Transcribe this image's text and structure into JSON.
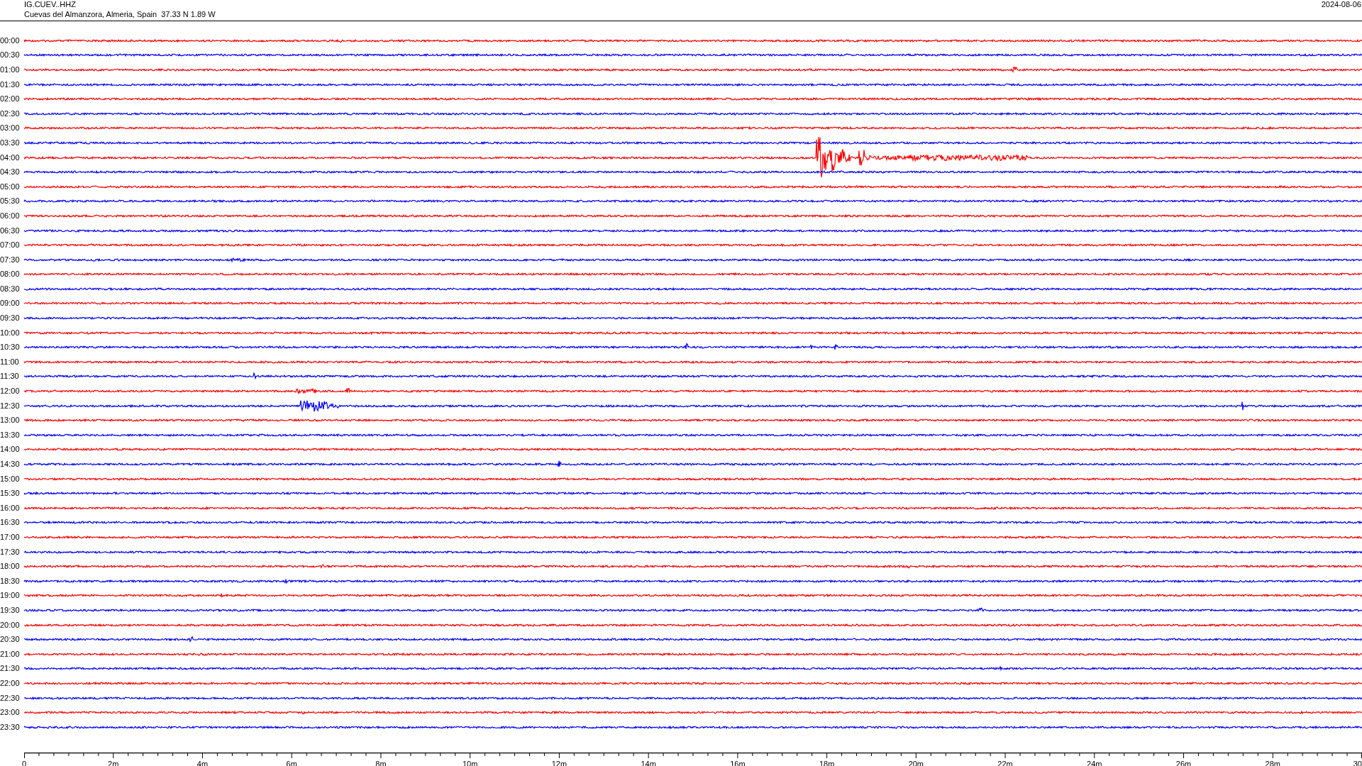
{
  "station": {
    "channel": "IG.CUEV..HHZ",
    "location": "Cuevas del Almanzora, Almeria, Spain  37.33 N 1.89 W",
    "date": "2024-08-06"
  },
  "traces": [
    {
      "time": "00:00",
      "color": "#ff0000"
    },
    {
      "time": "00:30",
      "color": "#0000ff"
    },
    {
      "time": "01:00",
      "color": "#ff0000"
    },
    {
      "time": "01:30",
      "color": "#0000ff"
    },
    {
      "time": "02:00",
      "color": "#ff0000"
    },
    {
      "time": "02:30",
      "color": "#0000ff"
    },
    {
      "time": "03:00",
      "color": "#ff0000"
    },
    {
      "time": "03:30",
      "color": "#0000ff"
    },
    {
      "time": "04:00",
      "color": "#ff0000"
    },
    {
      "time": "04:30",
      "color": "#0000ff"
    },
    {
      "time": "05:00",
      "color": "#ff0000"
    },
    {
      "time": "05:30",
      "color": "#0000ff"
    },
    {
      "time": "06:00",
      "color": "#ff0000"
    },
    {
      "time": "06:30",
      "color": "#0000ff"
    },
    {
      "time": "07:00",
      "color": "#ff0000"
    },
    {
      "time": "07:30",
      "color": "#0000ff"
    },
    {
      "time": "08:00",
      "color": "#ff0000"
    },
    {
      "time": "08:30",
      "color": "#0000ff"
    },
    {
      "time": "09:00",
      "color": "#ff0000"
    },
    {
      "time": "09:30",
      "color": "#0000ff"
    },
    {
      "time": "10:00",
      "color": "#ff0000"
    },
    {
      "time": "10:30",
      "color": "#0000ff"
    },
    {
      "time": "11:00",
      "color": "#ff0000"
    },
    {
      "time": "11:30",
      "color": "#0000ff"
    },
    {
      "time": "12:00",
      "color": "#ff0000"
    },
    {
      "time": "12:30",
      "color": "#0000ff"
    },
    {
      "time": "13:00",
      "color": "#ff0000"
    },
    {
      "time": "13:30",
      "color": "#0000ff"
    },
    {
      "time": "14:00",
      "color": "#ff0000"
    },
    {
      "time": "14:30",
      "color": "#0000ff"
    },
    {
      "time": "15:00",
      "color": "#ff0000"
    },
    {
      "time": "15:30",
      "color": "#0000ff"
    },
    {
      "time": "16:00",
      "color": "#ff0000"
    },
    {
      "time": "16:30",
      "color": "#0000ff"
    },
    {
      "time": "17:00",
      "color": "#ff0000"
    },
    {
      "time": "17:30",
      "color": "#0000ff"
    },
    {
      "time": "18:00",
      "color": "#ff0000"
    },
    {
      "time": "18:30",
      "color": "#0000ff"
    },
    {
      "time": "19:00",
      "color": "#ff0000"
    },
    {
      "time": "19:30",
      "color": "#0000ff"
    },
    {
      "time": "20:00",
      "color": "#ff0000"
    },
    {
      "time": "20:30",
      "color": "#0000ff"
    },
    {
      "time": "21:00",
      "color": "#ff0000"
    },
    {
      "time": "21:30",
      "color": "#0000ff"
    },
    {
      "time": "22:00",
      "color": "#ff0000"
    },
    {
      "time": "22:30",
      "color": "#0000ff"
    },
    {
      "time": "23:00",
      "color": "#ff0000"
    },
    {
      "time": "23:30",
      "color": "#0000ff"
    }
  ],
  "time_axis": {
    "ticks": [
      "0",
      "2m",
      "4m",
      "6m",
      "8m",
      "10m",
      "12m",
      "14m",
      "16m",
      "18m",
      "20m",
      "22m",
      "24m",
      "26m",
      "28m",
      "30"
    ]
  }
}
